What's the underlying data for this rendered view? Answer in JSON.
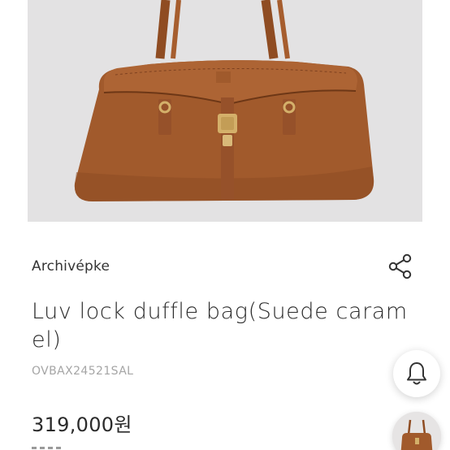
{
  "product": {
    "brand": "Archivépke",
    "title": "Luv lock duffle bag(Suede caramel)",
    "code": "OVBAX24521SAL",
    "price": "319,000원",
    "image_alt": "Suede caramel duffle bag with gold lock"
  },
  "icons": {
    "share": "share-icon",
    "bell": "bell-icon"
  },
  "colors": {
    "bag_suede": "#a15a2c",
    "hardware_gold": "#d4b06a",
    "image_bg": "#e3e2e3",
    "muted_text": "#a5a5a5"
  }
}
